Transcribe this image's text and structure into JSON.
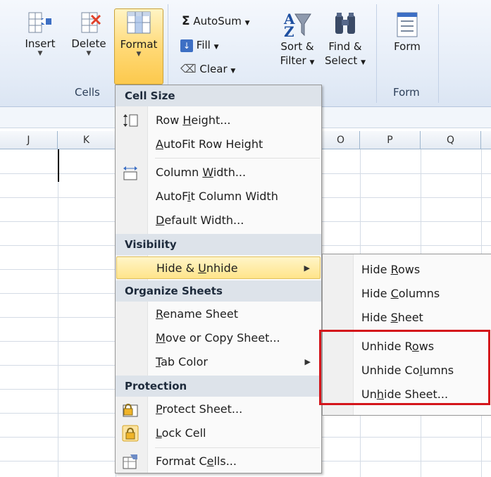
{
  "ribbon": {
    "insert": "Insert",
    "delete": "Delete",
    "format": "Format",
    "autosum": "AutoSum",
    "fill": "Fill",
    "clear": "Clear",
    "sort_filter_1": "Sort &",
    "sort_filter_2": "Filter",
    "find_select_1": "Find &",
    "find_select_2": "Select",
    "form": "Form",
    "cells_group": "Cells",
    "form_group": "Form"
  },
  "columns": [
    "J",
    "K",
    "O",
    "P",
    "Q"
  ],
  "format_menu": {
    "cell_size_header": "Cell Size",
    "row_height": {
      "pre": "Row ",
      "u": "H",
      "post": "eight..."
    },
    "autofit_row_height": {
      "pre": "",
      "u": "A",
      "post": "utoFit Row Height"
    },
    "column_width": {
      "pre": "Column ",
      "u": "W",
      "post": "idth..."
    },
    "autofit_column_width": {
      "pre": "AutoF",
      "u": "i",
      "post": "t Column Width"
    },
    "default_width": {
      "pre": "",
      "u": "D",
      "post": "efault Width..."
    },
    "visibility_header": "Visibility",
    "hide_unhide": {
      "pre": "Hide & ",
      "u": "U",
      "post": "nhide"
    },
    "organize_header": "Organize Sheets",
    "rename_sheet": {
      "pre": "",
      "u": "R",
      "post": "ename Sheet"
    },
    "move_copy_sheet": {
      "pre": "",
      "u": "M",
      "post": "ove or Copy Sheet..."
    },
    "tab_color": {
      "pre": "",
      "u": "T",
      "post": "ab Color"
    },
    "protection_header": "Protection",
    "protect_sheet": {
      "pre": "",
      "u": "P",
      "post": "rotect Sheet..."
    },
    "lock_cell": {
      "pre": "",
      "u": "L",
      "post": "ock Cell"
    },
    "format_cells": {
      "pre": "Format C",
      "u": "e",
      "post": "lls..."
    }
  },
  "hide_unhide_submenu": {
    "hide_rows": {
      "pre": "Hide ",
      "u": "R",
      "post": "ows"
    },
    "hide_columns": {
      "pre": "Hide ",
      "u": "C",
      "post": "olumns"
    },
    "hide_sheet": {
      "pre": "Hide ",
      "u": "S",
      "post": "heet"
    },
    "unhide_rows": {
      "pre": "Unhide R",
      "u": "o",
      "post": "ws"
    },
    "unhide_columns": {
      "pre": "Unhide Co",
      "u": "l",
      "post": "umns"
    },
    "unhide_sheet": {
      "pre": "Un",
      "u": "h",
      "post": "ide Sheet..."
    }
  },
  "colors": {
    "highlight_box": "#d4151b",
    "menu_highlight": "#ffe48a"
  }
}
